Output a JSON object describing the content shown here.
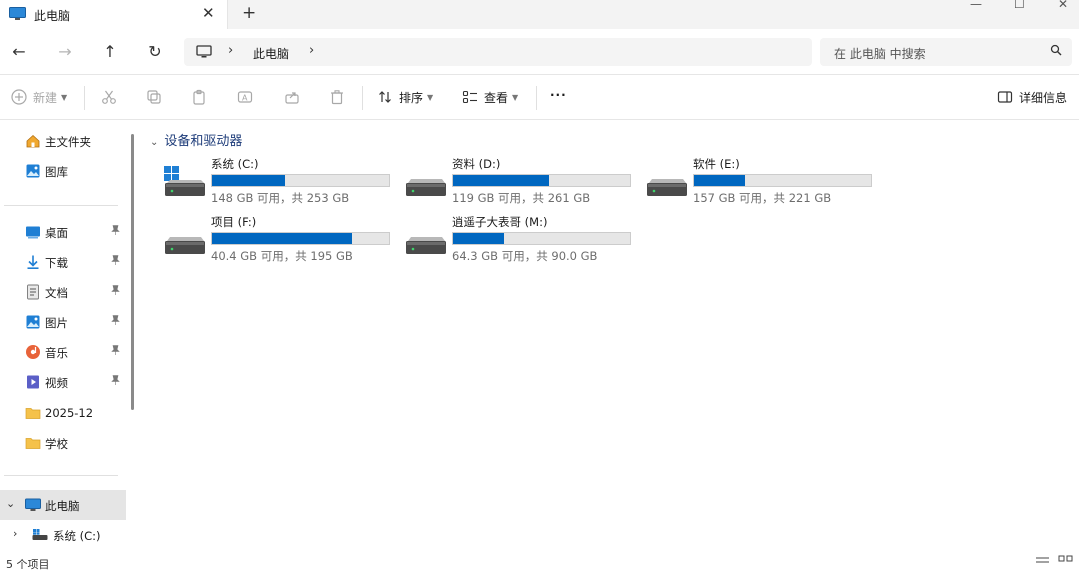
{
  "tab": {
    "title": "此电脑",
    "close": "✕",
    "new_tab": "+"
  },
  "window_controls": {
    "minimize": "—",
    "maximize": "☐",
    "close": "✕"
  },
  "nav": {
    "back": "←",
    "forward": "→",
    "up": "↑",
    "refresh": "↻"
  },
  "address": {
    "separator": "›",
    "crumb": "此电脑"
  },
  "search": {
    "placeholder": "在 此电脑 中搜索"
  },
  "commands": {
    "new": "新建",
    "sort": "排序",
    "view": "查看",
    "more": "···",
    "details": "详细信息"
  },
  "sidebar": {
    "top": [
      {
        "label": "主文件夹",
        "icon": "home-icon"
      },
      {
        "label": "图库",
        "icon": "gallery-icon"
      }
    ],
    "pinned": [
      {
        "label": "桌面",
        "icon": "desktop-icon",
        "pin": "📌"
      },
      {
        "label": "下载",
        "icon": "download-icon",
        "pin": "📌"
      },
      {
        "label": "文档",
        "icon": "document-icon",
        "pin": "📌"
      },
      {
        "label": "图片",
        "icon": "pictures-icon",
        "pin": "📌"
      },
      {
        "label": "音乐",
        "icon": "music-icon",
        "pin": "📌"
      },
      {
        "label": "视频",
        "icon": "video-icon",
        "pin": "📌"
      },
      {
        "label": "2025-12",
        "icon": "folder-icon"
      },
      {
        "label": "学校",
        "icon": "folder-icon"
      }
    ],
    "this_pc": {
      "label": "此电脑",
      "expand": "⌄"
    },
    "system_drive": {
      "label": "系统 (C:)",
      "expand": "›"
    }
  },
  "group": {
    "title": "设备和驱动器",
    "chevron": "⌄"
  },
  "drives": [
    {
      "name": "系统 (C:)",
      "info": "148 GB 可用，共 253 GB",
      "used_fraction": 0.415,
      "os": true
    },
    {
      "name": "资料 (D:)",
      "info": "119 GB 可用，共 261 GB",
      "used_fraction": 0.544,
      "os": false
    },
    {
      "name": "软件 (E:)",
      "info": "157 GB 可用，共 221 GB",
      "used_fraction": 0.29,
      "os": false
    },
    {
      "name": "项目 (F:)",
      "info": "40.4 GB 可用，共 195 GB",
      "used_fraction": 0.793,
      "os": false
    },
    {
      "name": "逍遥子大表哥 (M:)",
      "info": "64.3 GB 可用，共 90.0 GB",
      "used_fraction": 0.286,
      "os": false
    }
  ],
  "status": {
    "count": "5 个项目"
  },
  "colors": {
    "accent": "#0067c0",
    "bar_bg": "#e6e6e6",
    "selected": "#e5e5e5"
  }
}
